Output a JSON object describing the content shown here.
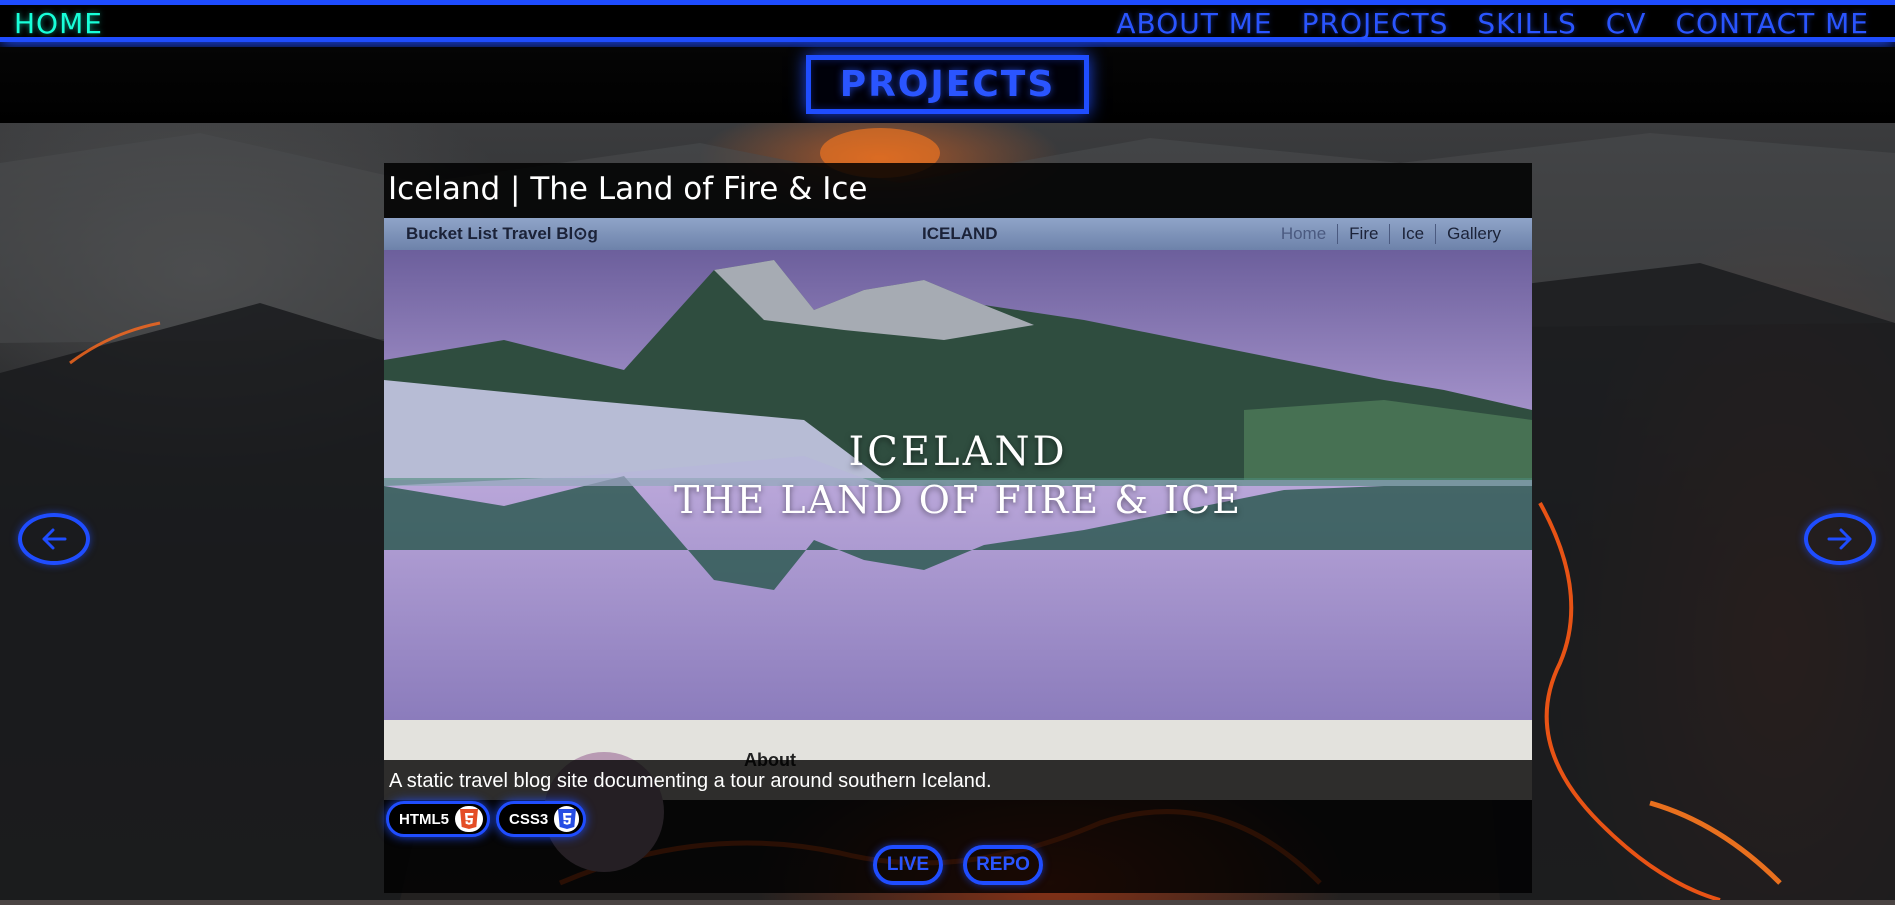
{
  "nav": {
    "home": "HOME",
    "links": [
      "ABOUT ME",
      "PROJECTS",
      "SKILLS",
      "CV",
      "CONTACT ME"
    ]
  },
  "page_title": "PROJECTS",
  "project": {
    "title": "Iceland | The Land of Fire & Ice",
    "preview": {
      "brand": "Bucket List Travel Bl⊙g",
      "center_title": "ICELAND",
      "links": [
        "Home",
        "Fire",
        "Ice",
        "Gallery"
      ],
      "hero_line1": "ICELAND",
      "hero_line2": "THE LAND OF FIRE & ICE",
      "about_heading": "About"
    },
    "description": "A static travel blog site documenting a tour around southern Iceland.",
    "badges": [
      {
        "label": "HTML5",
        "icon": "html5-icon"
      },
      {
        "label": "CSS3",
        "icon": "css3-icon"
      }
    ],
    "buttons": {
      "live": "LIVE",
      "repo": "REPO"
    }
  },
  "carousel": {
    "prev_icon": "arrow-left-icon",
    "next_icon": "arrow-right-icon"
  },
  "colors": {
    "accent": "#1f4dff",
    "home_link": "#18ffd8",
    "background": "#000000"
  }
}
